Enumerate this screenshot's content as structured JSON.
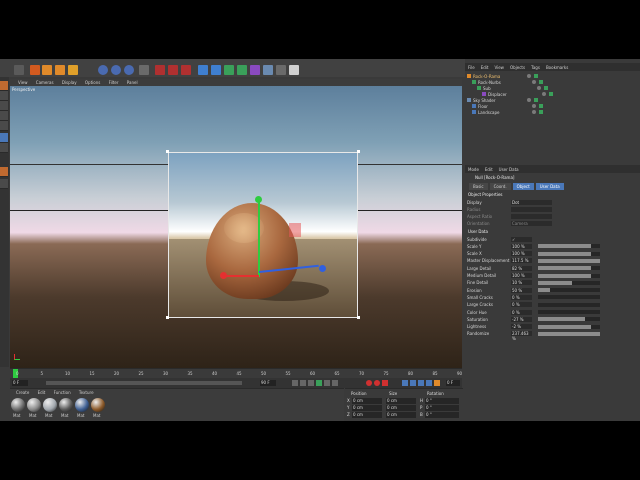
{
  "toolbar": {
    "icons": [
      "undo-icon",
      "move-icon",
      "scale-icon",
      "rotate-icon",
      "select-icon",
      "x-axis-icon",
      "y-axis-icon",
      "z-axis-icon",
      "world-icon",
      "render-icon",
      "render-view-icon",
      "render-settings-icon",
      "cube-icon",
      "pen-icon",
      "subdivision-icon",
      "array-icon",
      "deformer-icon",
      "scene-icon",
      "camera-icon",
      "light-icon"
    ]
  },
  "viewport": {
    "menu": [
      "View",
      "Cameras",
      "Display",
      "Options",
      "Filter",
      "Panel"
    ],
    "label": "Perspective"
  },
  "object_manager": {
    "menu": [
      "File",
      "Edit",
      "View",
      "Objects",
      "Tags",
      "Bookmarks"
    ],
    "items": [
      {
        "name": "Rock-O-Rama",
        "indent": 0
      },
      {
        "name": "Rock-Nurbs",
        "indent": 1
      },
      {
        "name": "Sub",
        "indent": 2
      },
      {
        "name": "Displacer",
        "indent": 3
      },
      {
        "name": "Sky Shader",
        "indent": 0
      },
      {
        "name": "Floor",
        "indent": 1
      },
      {
        "name": "Landscape",
        "indent": 1
      }
    ]
  },
  "attributes": {
    "menu": [
      "Mode",
      "Edit",
      "User Data"
    ],
    "title": "Null [Rock-O-Rama]",
    "tabs": [
      "Basic",
      "Coord.",
      "Object",
      "User Data"
    ],
    "active_tabs": [
      "Object",
      "User Data"
    ],
    "section": "Object Properties",
    "props": [
      {
        "label": "Display",
        "value": "Dot"
      },
      {
        "label": "Radius",
        "value": ""
      },
      {
        "label": "Aspect Ratio",
        "value": ""
      },
      {
        "label": "Orientation",
        "value": "Camera"
      }
    ],
    "user_section": "User Data",
    "user_rows": [
      {
        "label": "Subdivide",
        "value": "✓",
        "fill": 0
      },
      {
        "label": "Scale Y",
        "value": "100 %",
        "fill": 0.85
      },
      {
        "label": "Scale X",
        "value": "100 %",
        "fill": 0.85
      },
      {
        "label": "Master Displacement",
        "value": "117.5 %",
        "fill": 1.0
      },
      {
        "label": "Large Detail",
        "value": "82 %",
        "fill": 0.85
      },
      {
        "label": "Medium Detail",
        "value": "100 %",
        "fill": 0.85
      },
      {
        "label": "Fine Detail",
        "value": "10 %",
        "fill": 0.55
      },
      {
        "label": "Erosion",
        "value": "50 %",
        "fill": 0.2
      },
      {
        "label": "Small Cracks",
        "value": "0 %",
        "fill": 0.0
      },
      {
        "label": "Large Cracks",
        "value": "0 %",
        "fill": 0.0
      },
      {
        "label": "Color Hue",
        "value": "0 %",
        "fill": 0.0
      },
      {
        "label": "Saturation",
        "value": "-27 %",
        "fill": 0.75
      },
      {
        "label": "Lightness",
        "value": "-2 %",
        "fill": 0.85
      },
      {
        "label": "Randomize",
        "value": "237.463 %",
        "fill": 1.0
      }
    ]
  },
  "timeline": {
    "ticks": [
      "0",
      "5",
      "10",
      "15",
      "20",
      "25",
      "30",
      "35",
      "40",
      "45",
      "50",
      "55",
      "60",
      "65",
      "70",
      "75",
      "80",
      "85",
      "90"
    ],
    "start": "0 F",
    "end": "90 F",
    "current": "0 F"
  },
  "material_manager": {
    "menu": [
      "Create",
      "Edit",
      "Function",
      "Texture"
    ],
    "materials": [
      {
        "name": "Mat",
        "color": "#6d6d6d"
      },
      {
        "name": "Mat",
        "color": "#8a8a8a"
      },
      {
        "name": "Mat",
        "color": "#a2a8ae"
      },
      {
        "name": "Mat",
        "color": "#5a5a5a"
      },
      {
        "name": "Mat",
        "color": "#3e5f93"
      },
      {
        "name": "Mat",
        "color": "#8c5a2a"
      }
    ]
  },
  "coordinates": {
    "headers": [
      "Position",
      "Size",
      "Rotation"
    ],
    "rows": [
      {
        "axis": "X",
        "pos": "0 cm",
        "size": "0 cm",
        "rot_axis": "H",
        "rot": "0 °"
      },
      {
        "axis": "Y",
        "pos": "0 cm",
        "size": "0 cm",
        "rot_axis": "P",
        "rot": "0 °"
      },
      {
        "axis": "Z",
        "pos": "0 cm",
        "size": "0 cm",
        "rot_axis": "B",
        "rot": "0 °"
      }
    ]
  },
  "colors": {
    "accent": "#4a78b9",
    "rock_gradient_mid": "#a9683f"
  }
}
